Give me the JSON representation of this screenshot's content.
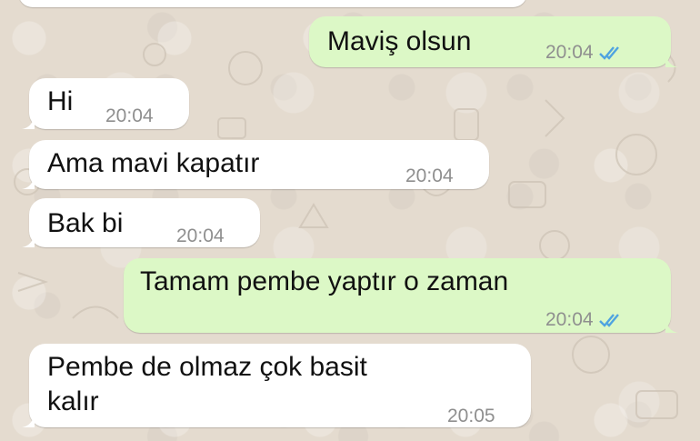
{
  "chat": {
    "messages": [
      {
        "direction": "out",
        "text": "Maviş olsun",
        "time": "20:04",
        "status": "read"
      },
      {
        "direction": "in",
        "text": "Hi",
        "time": "20:04"
      },
      {
        "direction": "in",
        "text": "Ama mavi kapatır",
        "time": "20:04"
      },
      {
        "direction": "in",
        "text": "Bak bi",
        "time": "20:04"
      },
      {
        "direction": "out",
        "text": "Tamam pembe yaptır o zaman",
        "time": "20:04",
        "status": "read"
      },
      {
        "direction": "in",
        "text_line1": "Pembe de olmaz çok basit",
        "text_line2": "kalır",
        "time": "20:05"
      }
    ]
  },
  "colors": {
    "incoming_bubble": "#ffffff",
    "outgoing_bubble": "#dcf8c6",
    "read_ticks": "#4fa3e0",
    "wallpaper": "#e4dbcf"
  },
  "icons": {
    "read_receipt": "double-check-icon"
  }
}
